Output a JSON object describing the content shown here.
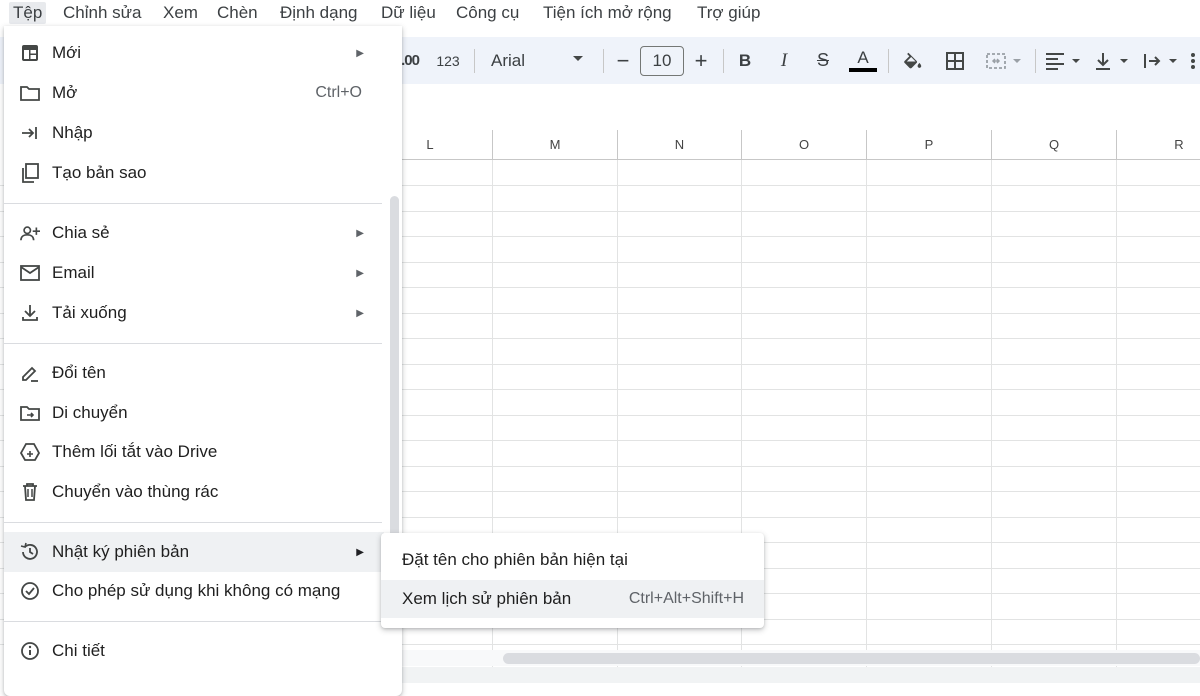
{
  "menubar": {
    "items": [
      "Tệp",
      "Chỉnh sửa",
      "Xem",
      "Chèn",
      "Định dạng",
      "Dữ liệu",
      "Công cụ",
      "Tiện ích mở rộng",
      "Trợ giúp"
    ]
  },
  "toolbar": {
    "decimal_label": ".00",
    "number_format_label": "123",
    "font_name": "Arial",
    "font_size": "10",
    "decrease_label": "−",
    "increase_label": "+",
    "bold_label": "B",
    "italic_label": "I",
    "strike_label": "S",
    "text_color_label": "A"
  },
  "grid": {
    "columns": [
      "L",
      "M",
      "N",
      "O",
      "P",
      "Q",
      "R"
    ]
  },
  "file_menu": {
    "items": [
      {
        "label": "Mới",
        "icon": "new-sheet-icon",
        "shortcut": "",
        "submenu": true
      },
      {
        "label": "Mở",
        "icon": "folder-icon",
        "shortcut": "Ctrl+O",
        "submenu": false
      },
      {
        "label": "Nhập",
        "icon": "import-icon",
        "shortcut": "",
        "submenu": false
      },
      {
        "label": "Tạo bản sao",
        "icon": "copy-icon",
        "shortcut": "",
        "submenu": false
      },
      {
        "label": "Chia sẻ",
        "icon": "share-person-icon",
        "shortcut": "",
        "submenu": true
      },
      {
        "label": "Email",
        "icon": "email-icon",
        "shortcut": "",
        "submenu": true
      },
      {
        "label": "Tải xuống",
        "icon": "download-icon",
        "shortcut": "",
        "submenu": true
      },
      {
        "label": "Đổi tên",
        "icon": "rename-icon",
        "shortcut": "",
        "submenu": false
      },
      {
        "label": "Di chuyển",
        "icon": "move-folder-icon",
        "shortcut": "",
        "submenu": false
      },
      {
        "label": "Thêm lối tắt vào Drive",
        "icon": "drive-shortcut-icon",
        "shortcut": "",
        "submenu": false
      },
      {
        "label": "Chuyển vào thùng rác",
        "icon": "trash-icon",
        "shortcut": "",
        "submenu": false
      },
      {
        "label": "Nhật ký phiên bản",
        "icon": "history-icon",
        "shortcut": "",
        "submenu": true
      },
      {
        "label": "Cho phép sử dụng khi không có mạng",
        "icon": "offline-check-icon",
        "shortcut": "",
        "submenu": false
      },
      {
        "label": "Chi tiết",
        "icon": "info-icon",
        "shortcut": "",
        "submenu": false
      }
    ]
  },
  "version_submenu": {
    "items": [
      {
        "label": "Đặt tên cho phiên bản hiện tại",
        "shortcut": ""
      },
      {
        "label": "Xem lịch sử phiên bản",
        "shortcut": "Ctrl+Alt+Shift+H"
      }
    ]
  },
  "colors": {
    "accent": "#1a73e8",
    "toolbar_bg": "#eff3fa",
    "hover_bg": "#eff1f3"
  }
}
